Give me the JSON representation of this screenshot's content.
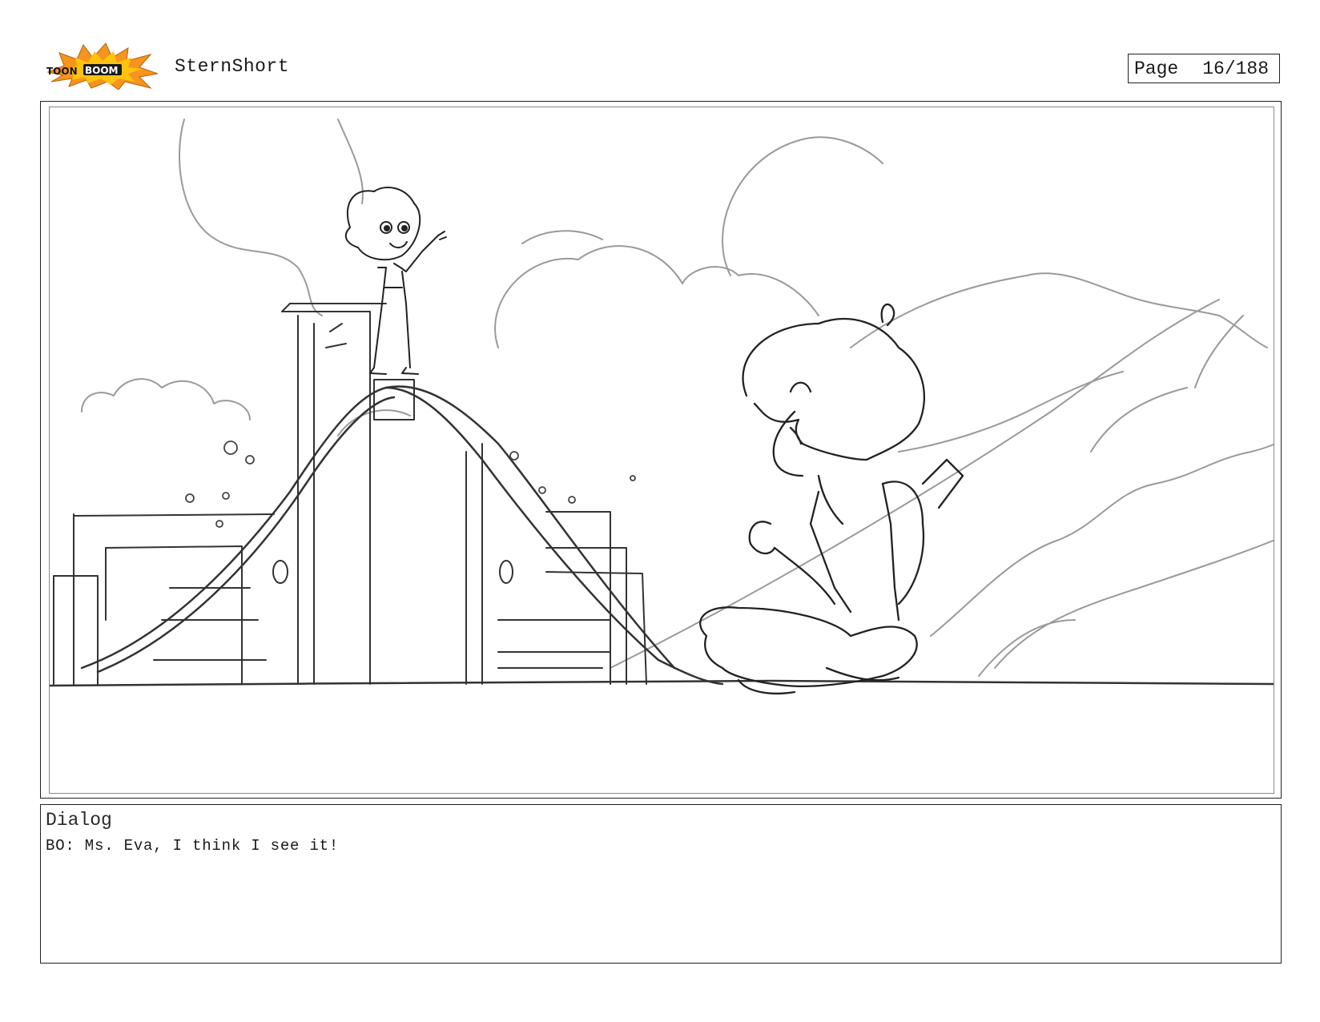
{
  "header": {
    "logo_text": "TOONBOOM",
    "project_title": "SternShort",
    "page_label": "Page",
    "page_number": "16/188"
  },
  "panel": {
    "image_type": "storyboard-sketch"
  },
  "dialog": {
    "label": "Dialog",
    "text": "BO: Ms. Eva, I think I see it!"
  },
  "colors": {
    "logo_burst": "#f7941d",
    "logo_burst_inner": "#ffc20e",
    "logo_text": "#111111",
    "border": "#222222",
    "sketch_line": "#333333",
    "sketch_light": "#9a9a9a"
  }
}
